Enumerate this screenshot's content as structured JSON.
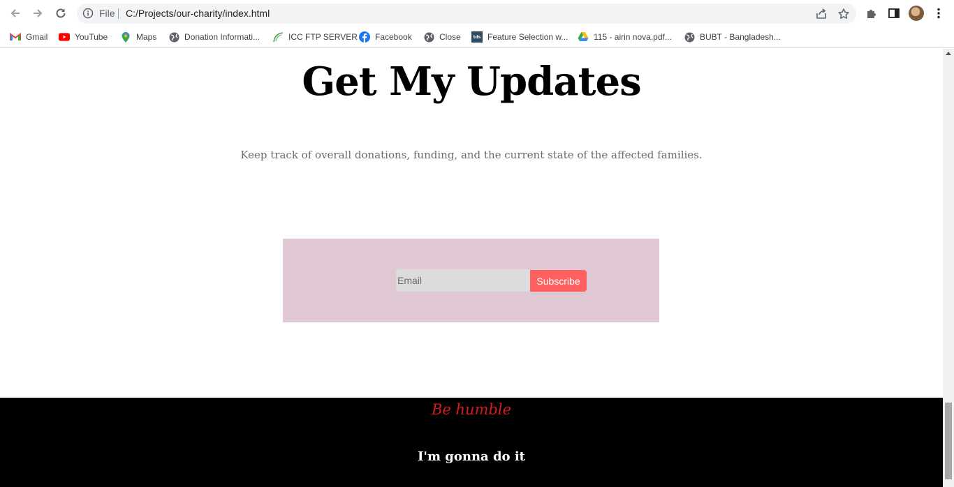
{
  "browser": {
    "omnibox": {
      "scheme_label": "File",
      "url": "C:/Projects/our-charity/index.html"
    },
    "bookmarks": [
      {
        "label": "Gmail",
        "icon": "gmail-icon"
      },
      {
        "label": "YouTube",
        "icon": "youtube-icon"
      },
      {
        "label": "Maps",
        "icon": "maps-icon"
      },
      {
        "label": "Donation Informati...",
        "icon": "globe-icon"
      },
      {
        "label": "ICC FTP SERVER",
        "icon": "icc-leaf-icon"
      },
      {
        "label": "Facebook",
        "icon": "facebook-icon"
      },
      {
        "label": "Close",
        "icon": "globe-icon"
      },
      {
        "label": "Feature Selection w...",
        "icon": "tds-icon",
        "icon_text": "tds"
      },
      {
        "label": "115 - airin nova.pdf...",
        "icon": "google-drive-icon"
      },
      {
        "label": "BUBT - Bangladesh...",
        "icon": "globe-icon"
      }
    ]
  },
  "page": {
    "heading": "Get My Updates",
    "description": "Keep track of overall donations, funding, and the current state of the affected families.",
    "subscribe": {
      "email_placeholder": "Email",
      "button_label": "Subscribe"
    },
    "footer": {
      "motto": "Be humble",
      "tagline": "I'm gonna do it"
    }
  },
  "colors": {
    "subscribe_box_bg": "#dfc8d3",
    "subscribe_button": "#ff5f5f",
    "motto": "#d41e1e",
    "footer_bg": "#000000"
  }
}
